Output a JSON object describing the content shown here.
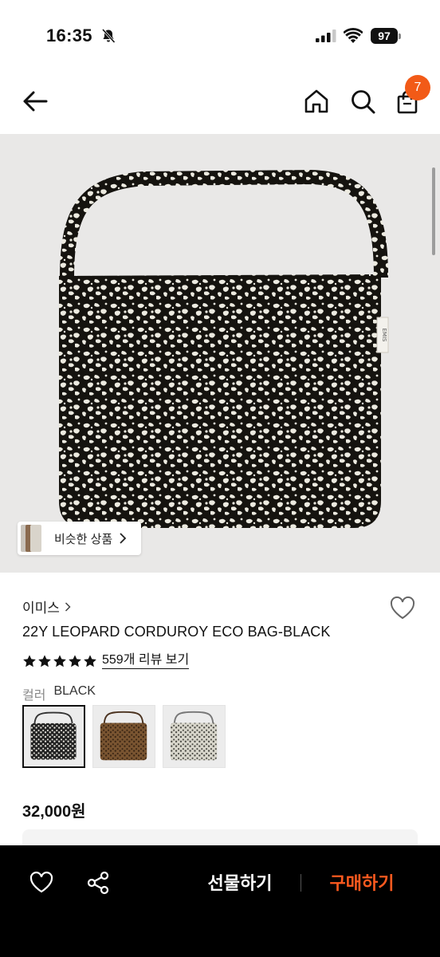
{
  "status_bar": {
    "time": "16:35",
    "battery_level": "97",
    "icons": [
      "bell-off-icon",
      "cellular-signal-icon",
      "wifi-icon",
      "battery-icon"
    ]
  },
  "nav": {
    "back_icon": "back-arrow-icon",
    "home_icon": "home-icon",
    "search_icon": "search-icon",
    "cart_icon": "shopping-bag-icon",
    "cart_count": "7"
  },
  "hero": {
    "image_subject": "leopard-print-tote-bag",
    "bag_tag_text": "EMIS",
    "similar_products_label": "비슷한 상품"
  },
  "product": {
    "brand": "이미스",
    "title": "22Y LEOPARD CORDUROY ECO BAG-BLACK",
    "rating_stars": 5,
    "review_link": "559개 리뷰 보기",
    "color_label": "컬러",
    "color_value": "BLACK",
    "swatches": [
      {
        "name": "black-leopard",
        "selected": true
      },
      {
        "name": "brown-leopard",
        "selected": false
      },
      {
        "name": "cream-leopard",
        "selected": false
      }
    ],
    "price": "32,000원"
  },
  "bottom_bar": {
    "gift_label": "선물하기",
    "buy_label": "구매하기"
  },
  "colors": {
    "accent": "#f25a17",
    "buy_text": "#ff5a1f",
    "bottom_bar_bg": "#000000",
    "hero_bg": "#e9e8e7"
  }
}
